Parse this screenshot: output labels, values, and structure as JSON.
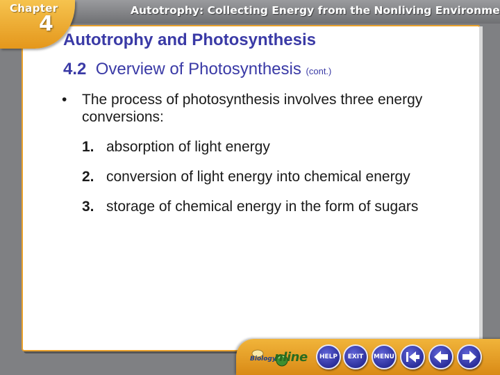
{
  "header": {
    "chapter_label": "Chapter",
    "chapter_number": "4",
    "chapter_title": "Autotrophy: Collecting Energy from the Nonliving Environment"
  },
  "slide": {
    "title": "Autotrophy and Photosynthesis",
    "section_number": "4.2",
    "section_title": "Overview of Photosynthesis",
    "continued": "(cont.)",
    "bullet_symbol": "•",
    "bullet_text": "The process of photosynthesis involves three energy conversions:",
    "items": [
      {
        "number": "1.",
        "text": "absorption of light energy"
      },
      {
        "number": "2.",
        "text": "conversion of light energy into chemical energy"
      },
      {
        "number": "3.",
        "text": "storage of chemical energy in the form of sugars"
      }
    ]
  },
  "navbar": {
    "logo_biology": "Biology",
    "logo_online": "nline",
    "help_label": "HELP",
    "exit_label": "EXIT",
    "menu_label": "MENU"
  },
  "colors": {
    "title_color": "#3a3aa6",
    "accent_orange": "#e9a02a",
    "button_blue": "#2b2f9b"
  }
}
